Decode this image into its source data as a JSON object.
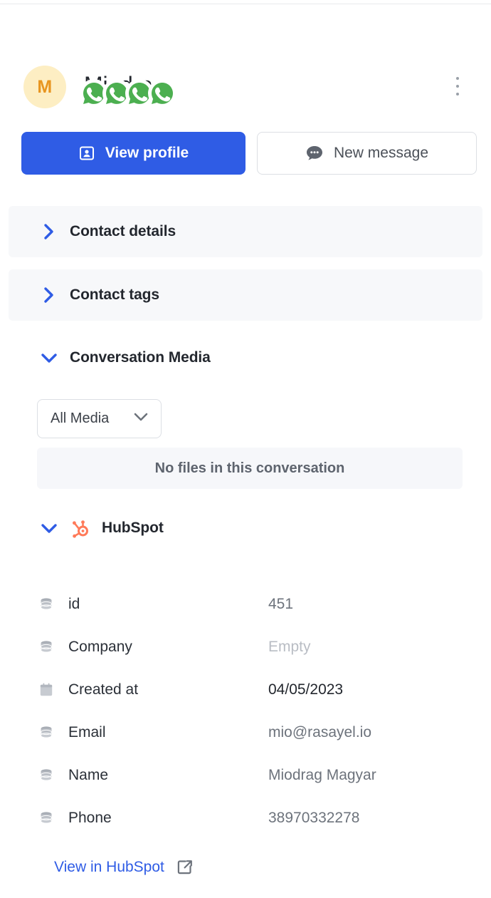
{
  "colors": {
    "accent_blue": "#2f5ce5",
    "avatar_bg": "#fdeec3",
    "avatar_fg": "#e8951f",
    "whatsapp_green": "#4caf50",
    "hubspot_orange": "#ff7a59",
    "section_shade": "#f7f8fa",
    "muted_text": "#b9bdc4"
  },
  "header": {
    "avatar_initial": "M",
    "contact_name": "Miodrag",
    "menu_icon": "kebab-menu-icon",
    "channel_count": 4,
    "channel_icon": "whatsapp-icon"
  },
  "actions": {
    "view_profile": {
      "label": "View profile",
      "icon": "contact-card-icon"
    },
    "new_message": {
      "label": "New message",
      "icon": "chat-bubble-icon"
    }
  },
  "sections": [
    {
      "id": "contact-details",
      "label": "Contact details",
      "expanded": false,
      "icon": "chevron-right-icon"
    },
    {
      "id": "contact-tags",
      "label": "Contact tags",
      "expanded": false,
      "icon": "chevron-right-icon"
    },
    {
      "id": "conversation-media",
      "label": "Conversation Media",
      "expanded": true,
      "icon": "chevron-down-icon"
    },
    {
      "id": "hubspot",
      "label": "HubSpot",
      "expanded": true,
      "icon": "chevron-down-icon",
      "logo": "hubspot-logo-icon"
    }
  ],
  "media": {
    "filter_value": "All Media",
    "filter_chevron": "chevron-down-icon",
    "empty_state": "No files in this conversation"
  },
  "hubspot": {
    "fields": [
      {
        "label": "id",
        "value": "451",
        "icon": "database-icon",
        "style": "normal"
      },
      {
        "label": "Company",
        "value": "Empty",
        "icon": "database-icon",
        "style": "muted"
      },
      {
        "label": "Created at",
        "value": "04/05/2023",
        "icon": "calendar-icon",
        "style": "strong"
      },
      {
        "label": "Email",
        "value": "mio@rasayel.io",
        "icon": "database-icon",
        "style": "normal"
      },
      {
        "label": "Name",
        "value": "Miodrag Magyar",
        "icon": "database-icon",
        "style": "normal"
      },
      {
        "label": "Phone",
        "value": "38970332278",
        "icon": "database-icon",
        "style": "normal"
      }
    ],
    "view_link": {
      "label": "View in HubSpot",
      "icon": "external-link-icon"
    }
  }
}
